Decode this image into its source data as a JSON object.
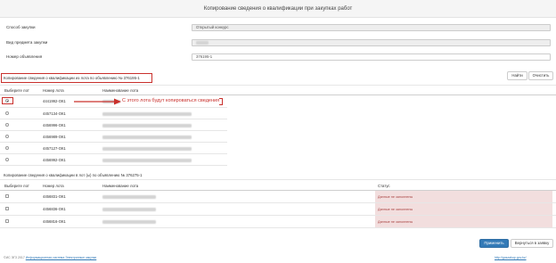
{
  "header": {
    "title": "Копирование сведения о квалификации при закупках работ"
  },
  "form": {
    "fields": [
      {
        "label": "Способ закупки",
        "value": "Открытый конкурс"
      },
      {
        "label": "Вид предмета закупки",
        "value": ""
      },
      {
        "label": "Номер объявления",
        "value": "376195-1"
      }
    ]
  },
  "section1": {
    "label": "Копирование сведения о квалификации из лота по объявлению № 376195-1"
  },
  "actions": {
    "find_label": "Найти",
    "clear_label": "Очистить"
  },
  "table1": {
    "headers": [
      "Выберите лот",
      "Номер лота",
      "Наименование лота"
    ],
    "rows": [
      {
        "lot": "4441992-ОК1",
        "selected": true
      },
      {
        "lot": "4457134-ОК1",
        "selected": false
      },
      {
        "lot": "4456996-ОК1",
        "selected": false
      },
      {
        "lot": "4456989-ОК1",
        "selected": false
      },
      {
        "lot": "4457127-ОК1",
        "selected": false
      },
      {
        "lot": "4456992-ОК1",
        "selected": false
      }
    ]
  },
  "annotation": {
    "text": "С этого лота будут копироваться сведения"
  },
  "section2": {
    "label": "Копирование сведения о квалификации в лот (ы) по объявлению № 376275-1"
  },
  "table2": {
    "headers": [
      "Выберите лот",
      "Номер лота",
      "Наименование лота",
      "Статус"
    ],
    "rows": [
      {
        "lot": "4456831-ОК1",
        "status": "Данные не заполнены"
      },
      {
        "lot": "4456836-ОК1",
        "status": "Данные не заполнены"
      },
      {
        "lot": "4456816-ОК1",
        "status": "Данные не заполнены"
      }
    ]
  },
  "buttons": {
    "apply_label": "Применить",
    "back_label": "Вернуться в заявку"
  },
  "footer": {
    "left_prefix": "©ИС ЭГЗ 2017 ",
    "left_link": "Информационная система Электронные закупки",
    "right_link": "http://goszakup.gov.kz/"
  },
  "colors": {
    "accent": "#337ab7",
    "highlight": "#c9302c",
    "status_bg": "#f2dede",
    "status_text": "#a94442"
  }
}
